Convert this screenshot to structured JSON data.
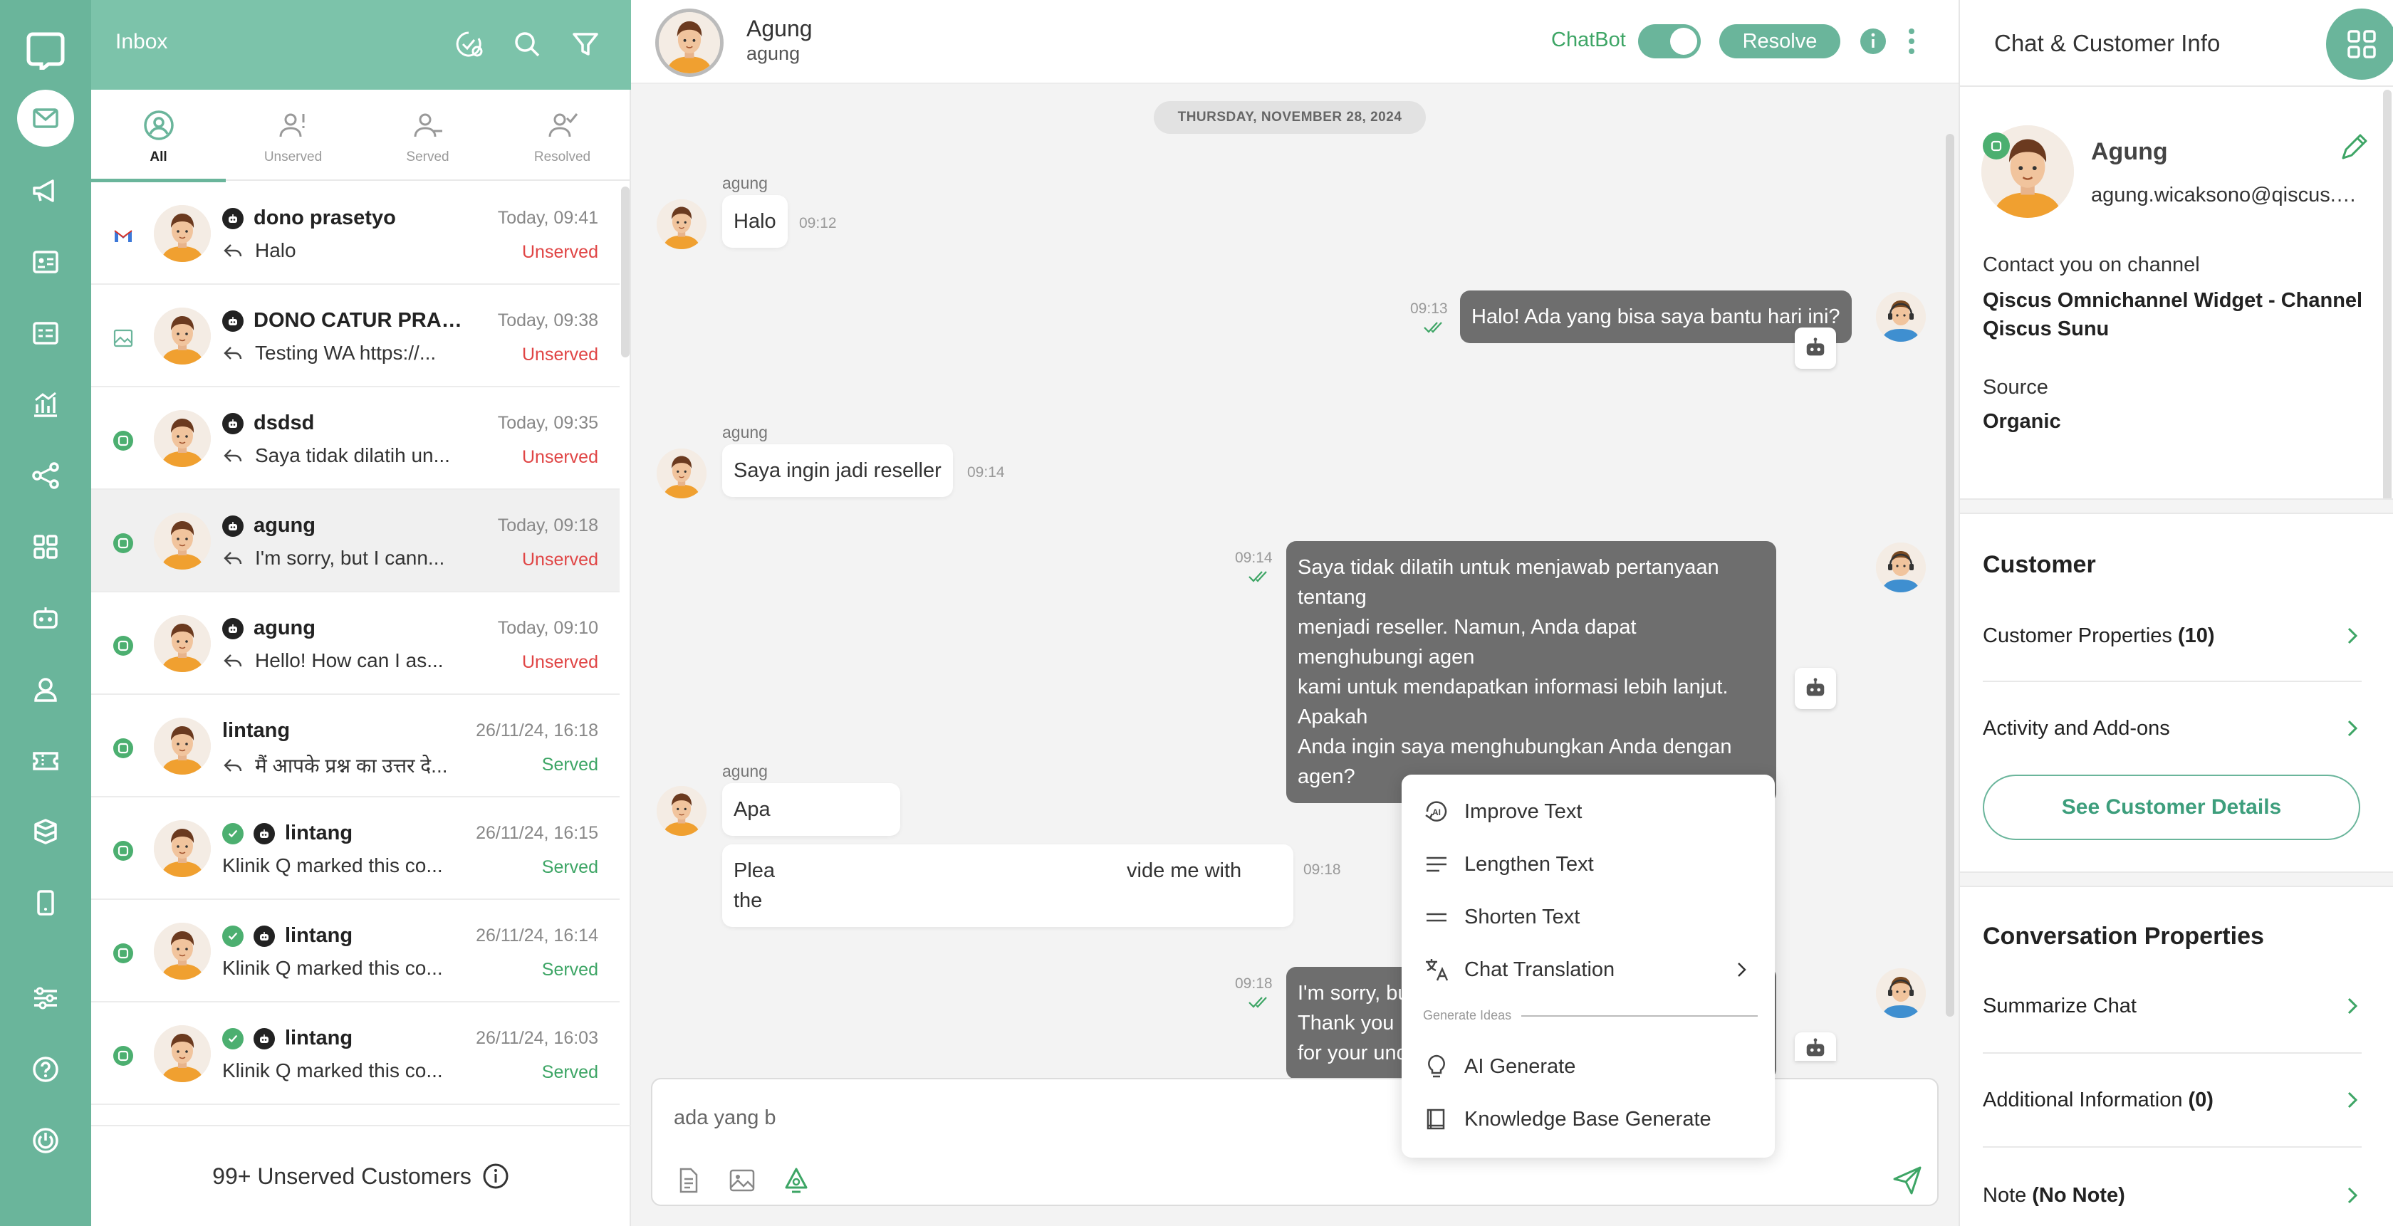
{
  "colors": {
    "brand": "#6ab59b",
    "brand_light": "#7cc3aa",
    "unserved": "#e04545",
    "served": "#3da565",
    "agent_bubble": "#6e6e6e"
  },
  "rail": {
    "items": [
      "app-logo-icon",
      "inbox-icon",
      "megaphone-icon",
      "contacts-icon",
      "forms-icon",
      "analytics-icon",
      "integration-icon",
      "apps-icon",
      "chatbot-icon",
      "agent-icon",
      "ticket-icon",
      "storage-icon",
      "mobile-icon",
      "settings-icon",
      "help-icon",
      "power-icon"
    ]
  },
  "inbox": {
    "title": "Inbox",
    "tabs": [
      {
        "label": "All"
      },
      {
        "label": "Unserved"
      },
      {
        "label": "Served"
      },
      {
        "label": "Resolved"
      }
    ],
    "items": [
      {
        "name": "dono prasetyo",
        "time": "Today, 09:41",
        "preview": "Halo",
        "status": "Unserved",
        "status_class": "unserved",
        "channel": "email",
        "check": false,
        "reply": true
      },
      {
        "name": "DONO CATUR PRAS...",
        "time": "Today, 09:38",
        "preview": "Testing WA https://...",
        "status": "Unserved",
        "status_class": "unserved",
        "channel": "image",
        "check": false,
        "reply": true
      },
      {
        "name": "dsdsd",
        "time": "Today, 09:35",
        "preview": "Saya tidak dilatih un...",
        "status": "Unserved",
        "status_class": "unserved",
        "channel": "qiscus",
        "check": false,
        "reply": true
      },
      {
        "name": "agung",
        "time": "Today, 09:18",
        "preview": "I'm sorry, but I cann...",
        "status": "Unserved",
        "status_class": "unserved",
        "channel": "qiscus",
        "check": false,
        "reply": true,
        "selected": true
      },
      {
        "name": "agung",
        "time": "Today, 09:10",
        "preview": "Hello! How can I as...",
        "status": "Unserved",
        "status_class": "unserved",
        "channel": "qiscus",
        "check": false,
        "reply": true
      },
      {
        "name": "lintang",
        "time": "26/11/24, 16:18",
        "preview": "मैं आपके प्रश्न का उत्तर दे...",
        "status": "Served",
        "status_class": "served",
        "channel": "qiscus",
        "check": false,
        "reply": true,
        "nobot": true
      },
      {
        "name": "lintang",
        "time": "26/11/24, 16:15",
        "preview": "Klinik Q marked this co...",
        "status": "Served",
        "status_class": "served",
        "channel": "qiscus",
        "check": true,
        "reply": false
      },
      {
        "name": "lintang",
        "time": "26/11/24, 16:14",
        "preview": "Klinik Q marked this co...",
        "status": "Served",
        "status_class": "served",
        "channel": "qiscus",
        "check": true,
        "reply": false
      },
      {
        "name": "lintang",
        "time": "26/11/24, 16:03",
        "preview": "Klinik Q marked this co...",
        "status": "Served",
        "status_class": "served",
        "channel": "qiscus",
        "check": true,
        "reply": false
      }
    ],
    "unserved_footer": "99+ Unserved Customers"
  },
  "chat": {
    "contact_name": "Agung",
    "contact_sub": "agung",
    "chatbot_label": "ChatBot",
    "chatbot_enabled": true,
    "resolve_label": "Resolve",
    "date_chip": "THURSDAY, NOVEMBER 28, 2024",
    "messages": [
      {
        "sender": "agung",
        "text": "Halo",
        "time": "09:12"
      },
      {
        "text": "Halo! Ada yang bisa saya bantu hari ini?",
        "time": "09:13"
      },
      {
        "sender": "agung",
        "text": "Saya ingin jadi reseller",
        "time": "09:14"
      },
      {
        "text_lines": [
          "Saya tidak dilatih untuk menjawab pertanyaan tentang",
          "menjadi reseller. Namun, Anda dapat menghubungi agen",
          "kami untuk mendapatkan informasi lebih lanjut. Apakah",
          "Anda ingin saya menghubungkan Anda dengan agen?"
        ],
        "time": "09:14"
      },
      {
        "sender": "agung",
        "text": "Apa",
        "time": ""
      },
      {
        "text_lines": [
          "Plea",
          "vide me with",
          "the"
        ],
        "time": "09:18"
      },
      {
        "text_lines": [
          "I'm sorry, but I cannot assist with that request. Thank you",
          "for your understanding."
        ],
        "time": "09:18"
      }
    ],
    "composer_text": "ada yang b"
  },
  "ai_menu": {
    "items": [
      {
        "label": "Improve Text",
        "icon": "ai-improve-icon"
      },
      {
        "label": "Lengthen Text",
        "icon": "lengthen-icon"
      },
      {
        "label": "Shorten Text",
        "icon": "shorten-icon"
      },
      {
        "label": "Chat Translation",
        "icon": "translate-icon"
      }
    ],
    "section_label": "Generate Ideas",
    "generate_items": [
      {
        "label": "AI Generate",
        "icon": "lightbulb-icon"
      },
      {
        "label": "Knowledge Base Generate",
        "icon": "book-icon"
      }
    ]
  },
  "right": {
    "title": "Chat & Customer Info",
    "customer_name": "Agung",
    "customer_email": "agung.wicaksono@qiscus.com",
    "channel_label": "Contact you on channel",
    "channel_value": "Qiscus Omnichannel Widget - Channel Qiscus Sunu",
    "source_label": "Source",
    "source_value": "Organic",
    "customer_section": "Customer",
    "customer_properties": "Customer Properties",
    "customer_properties_count": "(10)",
    "activity": "Activity and Add-ons",
    "see_details": "See Customer Details",
    "conversation_section": "Conversation Properties",
    "summarize": "Summarize Chat",
    "additional_info": "Additional Information",
    "additional_info_count": "(0)",
    "note": "Note",
    "note_value": "(No Note)"
  }
}
